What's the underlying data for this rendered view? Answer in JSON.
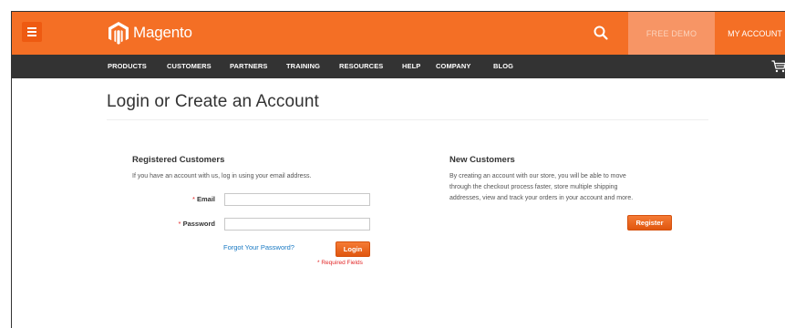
{
  "header": {
    "logo_text": "Magento",
    "free_demo": "FREE DEMO",
    "my_account": "MY ACCOUNT",
    "colors": {
      "brand": "#f46f25",
      "nav_bg": "#333333",
      "link": "#1979c3",
      "required": "#e22626"
    }
  },
  "nav": {
    "items": [
      "PRODUCTS",
      "CUSTOMERS",
      "PARTNERS",
      "TRAINING",
      "RESOURCES",
      "HELP",
      "COMPANY",
      "BLOG"
    ]
  },
  "page": {
    "title": "Login or Create an Account"
  },
  "registered": {
    "title": "Registered Customers",
    "intro": "If you have an account with us, log in using your email address.",
    "email_label": "Email",
    "password_label": "Password",
    "email_value": "",
    "password_value": "",
    "forgot_link": "Forgot Your Password?",
    "login_button": "Login",
    "required_note": "* Required Fields"
  },
  "new_customers": {
    "title": "New Customers",
    "line1": "By creating an account with our store, you will be able to move",
    "line2": "through the checkout process faster, store multiple shipping",
    "line3": "addresses, view and track your orders in your account and more.",
    "register_button": "Register"
  }
}
